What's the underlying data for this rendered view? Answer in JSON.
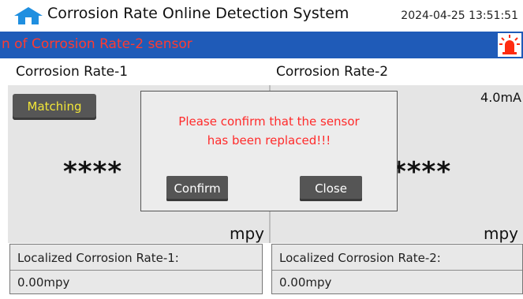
{
  "header": {
    "title": "Corrosion Rate Online Detection System",
    "datetime": "2024-04-25 13:51:51",
    "home_icon": "home-icon"
  },
  "alarm": {
    "message": "n of Corrosion Rate-2 sensor",
    "icon": "alarm-light-icon",
    "bar_color": "#1f5bb8",
    "text_color": "#ff3b30"
  },
  "left": {
    "heading": "Corrosion Rate-1",
    "match_label": "Matching",
    "value": "****",
    "unit": "mpy",
    "localized_label": "Localized Corrosion Rate-1:",
    "localized_value": "0.00mpy"
  },
  "right": {
    "heading": "Corrosion Rate-2",
    "current": "4.0mA",
    "value": "****",
    "unit": "mpy",
    "localized_label": "Localized Corrosion Rate-2:",
    "localized_value": "0.00mpy"
  },
  "modal": {
    "line1": "Please confirm that the sensor",
    "line2": "has been replaced!!!",
    "confirm_label": "Confirm",
    "close_label": "Close"
  }
}
